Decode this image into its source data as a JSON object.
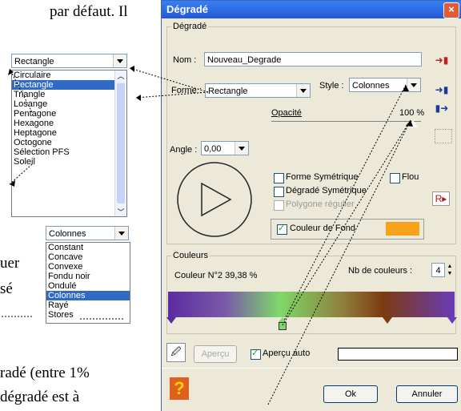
{
  "background_text": {
    "line1": "par défaut. Il",
    "line2_fragment": "uer",
    "line3_fragment": "sé",
    "line4": "radé (entre 1%",
    "line5": " dégradé est à"
  },
  "forme_popup": {
    "selected_value": "Rectangle",
    "items": [
      "Circulaire",
      "Rectangle",
      "Triangle",
      "Losange",
      "Pentagone",
      "Hexagone",
      "Heptagone",
      "Octogone",
      "Sélection PFS",
      "Soleil"
    ],
    "selected_index": 1
  },
  "style_popup": {
    "selected_value": "Colonnes",
    "items": [
      "Constant",
      "Concave",
      "Convexe",
      "Fondu noir",
      "Ondulé",
      "Colonnes",
      "Rayé",
      "Stores"
    ],
    "selected_index": 5
  },
  "dialog": {
    "title": "Dégradé",
    "group_label": "Dégradé",
    "nom_label": "Nom :",
    "nom_value": "Nouveau_Degrade",
    "forme_label": "Forme :",
    "forme_value": "Rectangle",
    "style_label": "Style :",
    "style_value": "Colonnes",
    "opacite_label": "Opacité",
    "opacite_value": "100 %",
    "angle_label": "Angle :",
    "angle_value": "0,00",
    "forme_sym": "Forme Symétrique",
    "flou": "Flou",
    "degrade_sym": "Dégradé Symétrique",
    "polygone": "Polygone régulier",
    "couleur_fond": "Couleur de Fond",
    "couleur_fond_color": "#f7a21b",
    "couleurs_label": "Couleurs",
    "couleur_n": "Couleur N°2 39,38 %",
    "nb_couleurs_label": "Nb de couleurs :",
    "nb_couleurs_value": "4",
    "apercu_btn": "Aperçu",
    "apercu_auto": "Aperçu auto",
    "ok": "Ok",
    "annuler": "Annuler"
  }
}
